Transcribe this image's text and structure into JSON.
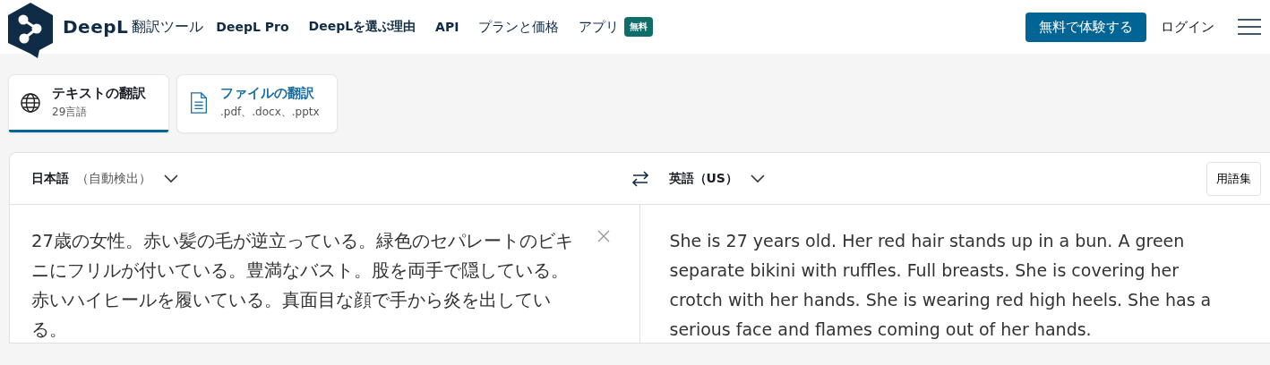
{
  "header": {
    "brand": "DeepL",
    "product": "翻訳ツール",
    "nav": [
      {
        "label": "DeepL Pro",
        "kind": "bold"
      },
      {
        "label": "DeepLを選ぶ理由",
        "kind": "bold"
      },
      {
        "label": "API",
        "kind": "bold"
      },
      {
        "label": "プランと価格",
        "kind": "plain"
      },
      {
        "label": "アプリ",
        "kind": "plain",
        "badge": "無料"
      }
    ],
    "cta": "無料で体験する",
    "login": "ログイン"
  },
  "modes": [
    {
      "title": "テキストの翻訳",
      "subtitle": "29言語",
      "kind": "text",
      "selected": true
    },
    {
      "title": "ファイルの翻訳",
      "subtitle": ".pdf、.docx、.pptx",
      "kind": "file",
      "selected": false
    }
  ],
  "translator": {
    "source_language": "日本語",
    "source_note": "（自動検出）",
    "target_language": "英語（US）",
    "glossary": "用語集",
    "source_text": "27歳の女性。赤い髪の毛が逆立っている。緑色のセパレートのビキニにフリルが付いている。豊満なバスト。股を両手で隠している。赤いハイヒールを履いている。真面目な顔で手から炎を出している。",
    "target_text": "She is 27 years old. Her red hair stands up in a bun. A green separate bikini with ruffles. Full breasts. She is covering her crotch with her hands. She is wearing red high heels. She has a serious face and flames coming out of her hands."
  }
}
